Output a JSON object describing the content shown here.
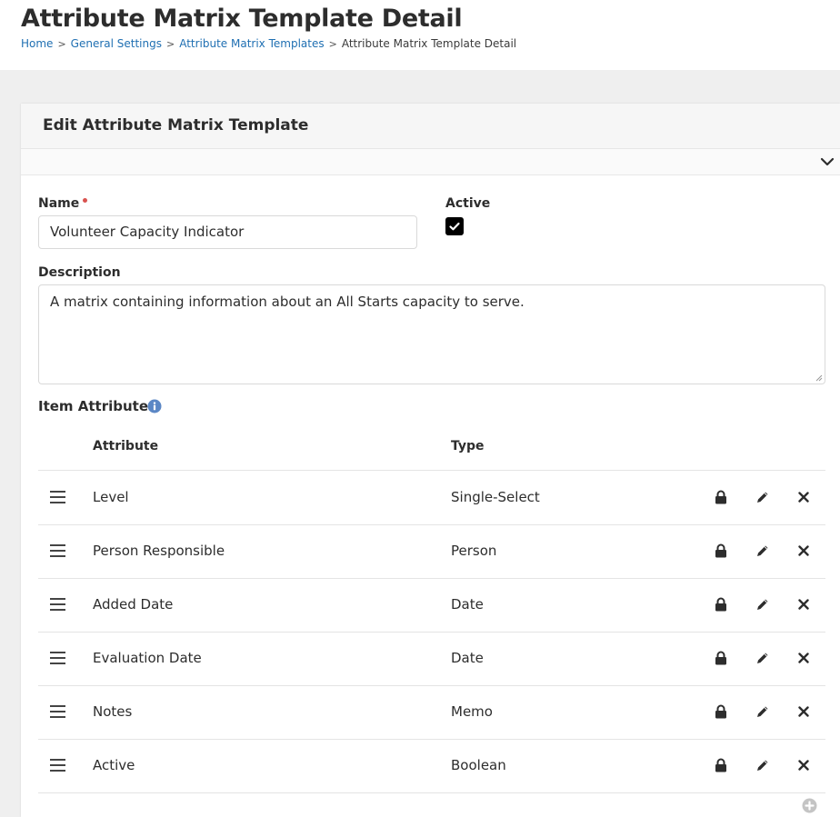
{
  "page": {
    "title": "Attribute Matrix Template Detail",
    "breadcrumb": [
      {
        "label": "Home",
        "link": true
      },
      {
        "label": "General Settings",
        "link": true
      },
      {
        "label": "Attribute Matrix Templates",
        "link": true
      },
      {
        "label": "Attribute Matrix Template Detail",
        "link": false
      }
    ]
  },
  "panel": {
    "title": "Edit Attribute Matrix Template"
  },
  "form": {
    "name_label": "Name",
    "name_value": "Volunteer Capacity Indicator",
    "name_required": true,
    "active_label": "Active",
    "active_checked": true,
    "description_label": "Description",
    "description_value": "A matrix containing information about an All Starts capacity to serve."
  },
  "item_attributes": {
    "title": "Item Attributes",
    "columns": {
      "attribute": "Attribute",
      "type": "Type"
    },
    "rows": [
      {
        "attribute": "Level",
        "type": "Single-Select"
      },
      {
        "attribute": "Person Responsible",
        "type": "Person"
      },
      {
        "attribute": "Added Date",
        "type": "Date"
      },
      {
        "attribute": "Evaluation Date",
        "type": "Date"
      },
      {
        "attribute": "Notes",
        "type": "Memo"
      },
      {
        "attribute": "Active",
        "type": "Boolean"
      }
    ]
  },
  "icons": {
    "drawer_toggle": "chevron-down-icon",
    "info": "info-icon",
    "drag": "drag-handle-icon",
    "lock": "lock-icon",
    "edit": "pencil-icon",
    "delete": "close-icon",
    "add": "add-circle-icon"
  },
  "colors": {
    "link": "#1f6fb2",
    "required": "#d9534f",
    "info_icon": "#5b87c5",
    "page_background": "#efefef"
  }
}
